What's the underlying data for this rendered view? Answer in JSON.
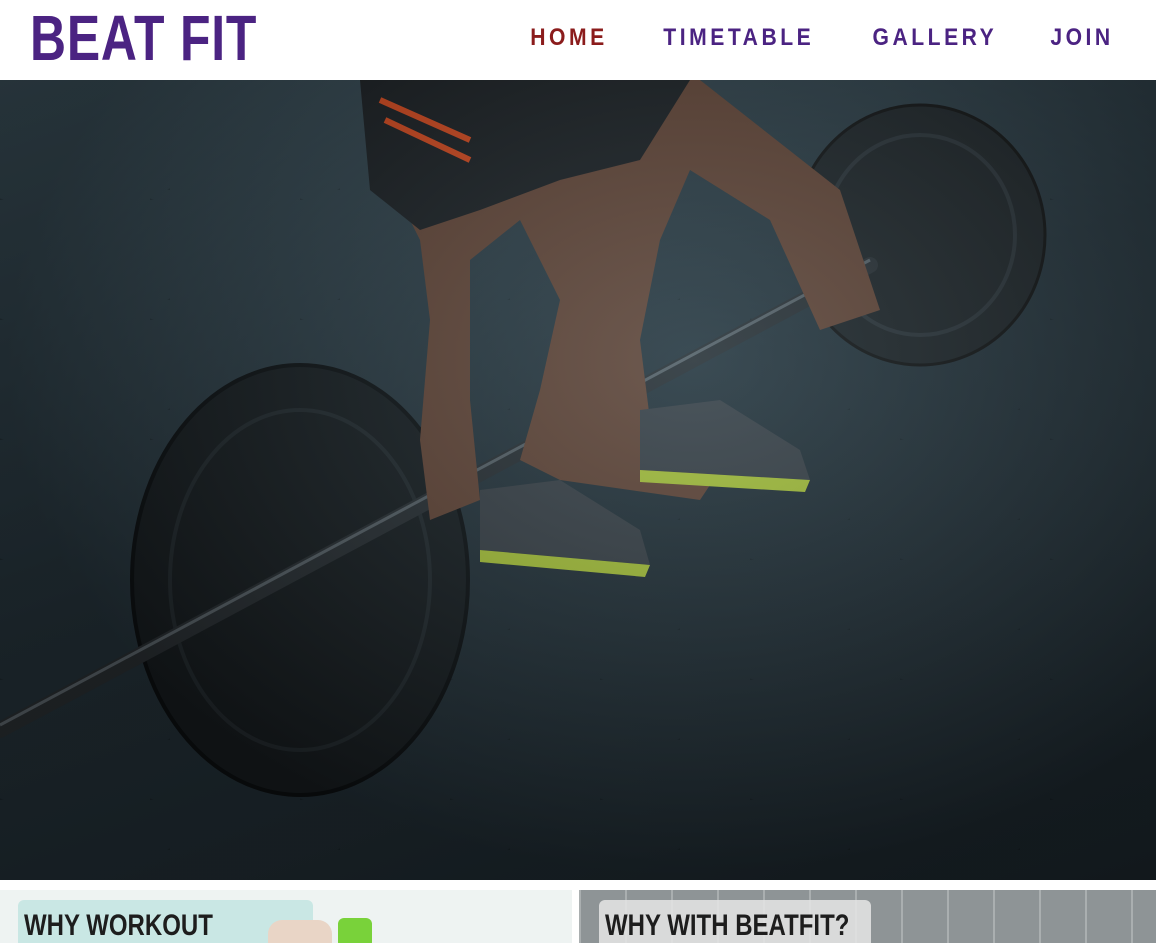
{
  "brand": {
    "logo": "BEAT FIT",
    "color": "#4b2382"
  },
  "nav": {
    "items": [
      {
        "label": "HOME",
        "active": true
      },
      {
        "label": "TIMETABLE",
        "active": false
      },
      {
        "label": "GALLERY",
        "active": false
      },
      {
        "label": "JOIN",
        "active": false
      }
    ],
    "active_color": "#8b1c1c"
  },
  "cards": [
    {
      "title": "WHY WORKOUT"
    },
    {
      "title": "WHY WITH BEATFIT?"
    }
  ]
}
